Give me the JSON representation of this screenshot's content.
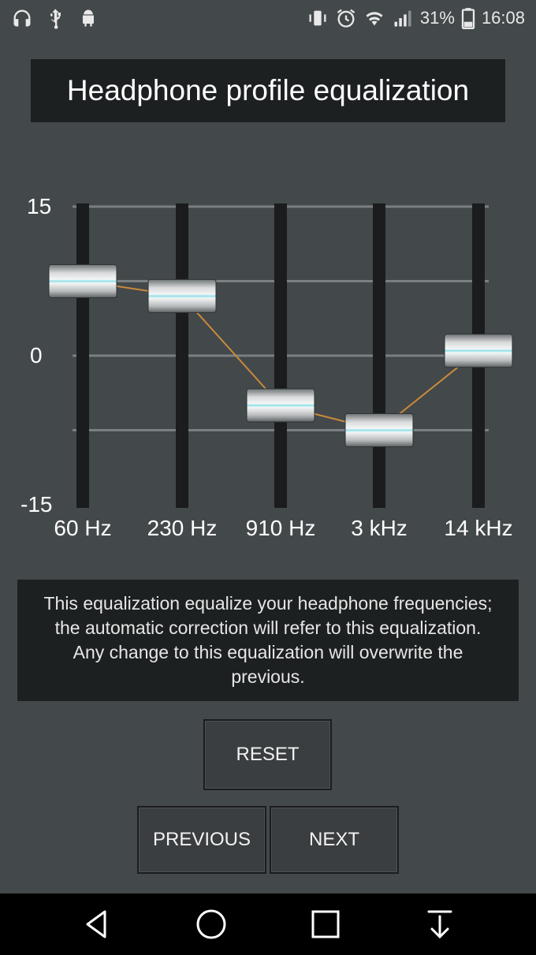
{
  "status_bar": {
    "battery": "31%",
    "time": "16:08",
    "icons_left": [
      "headphones-icon",
      "usb-icon",
      "android-icon"
    ],
    "icons_right": [
      "vibrate-icon",
      "alarm-icon",
      "wifi-icon",
      "signal-icon",
      "battery-icon"
    ]
  },
  "title": "Headphone profile equalization",
  "equalizer": {
    "y_axis": {
      "max_label": "15",
      "mid_label": "0",
      "min_label": "-15",
      "min": -15,
      "max": 15
    },
    "bands": [
      {
        "label": "60 Hz",
        "value": 7.5
      },
      {
        "label": "230 Hz",
        "value": 6
      },
      {
        "label": "910 Hz",
        "value": -5
      },
      {
        "label": "3 kHz",
        "value": -7.5
      },
      {
        "label": "14 kHz",
        "value": 0.5
      }
    ],
    "colors": {
      "track": "#1a1c1d",
      "grid": "#7a7f82",
      "curve": "#c98a3a",
      "knob": "#d8dadb",
      "knob_glow": "#8fe0e8"
    }
  },
  "description": "This equalization equalize your headphone frequencies; the automatic correction will refer to this equalization. Any change to this equalization will overwrite the previous.",
  "buttons": {
    "reset": "RESET",
    "previous": "PREVIOUS",
    "next": "NEXT"
  },
  "nav_bar": {
    "icons": [
      "back-icon",
      "home-icon",
      "recents-icon",
      "notification-down-icon"
    ]
  }
}
